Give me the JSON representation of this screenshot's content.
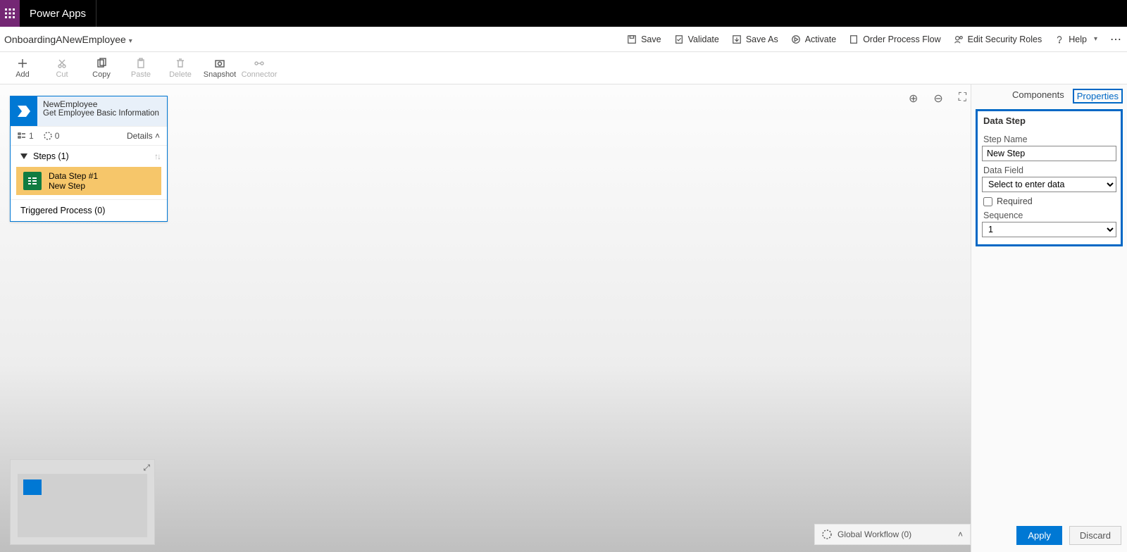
{
  "app": {
    "title": "Power Apps"
  },
  "process": {
    "name": "OnboardingANewEmployee"
  },
  "commands": {
    "save": "Save",
    "validate": "Validate",
    "saveAs": "Save As",
    "activate": "Activate",
    "order": "Order Process Flow",
    "security": "Edit Security Roles",
    "help": "Help"
  },
  "ribbon": {
    "add": "Add",
    "cut": "Cut",
    "copy": "Copy",
    "paste": "Paste",
    "delete": "Delete",
    "snapshot": "Snapshot",
    "connector": "Connector"
  },
  "stage": {
    "name": "NewEmployee",
    "subtitle": "Get Employee Basic Information",
    "stepCount": "1",
    "branchCount": "0",
    "details": "Details",
    "steps_header": "Steps (1)",
    "step1_title": "Data Step #1",
    "step1_sub": "New Step",
    "triggered": "Triggered Process (0)"
  },
  "globalWorkflow": "Global Workflow (0)",
  "tabs": {
    "components": "Components",
    "properties": "Properties"
  },
  "props": {
    "title": "Data Step",
    "stepNameLabel": "Step Name",
    "stepNameValue": "New Step",
    "dataFieldLabel": "Data Field",
    "dataFieldPlaceholder": "Select to enter data",
    "requiredLabel": "Required",
    "sequenceLabel": "Sequence",
    "sequenceValue": "1"
  },
  "actions": {
    "apply": "Apply",
    "discard": "Discard"
  }
}
